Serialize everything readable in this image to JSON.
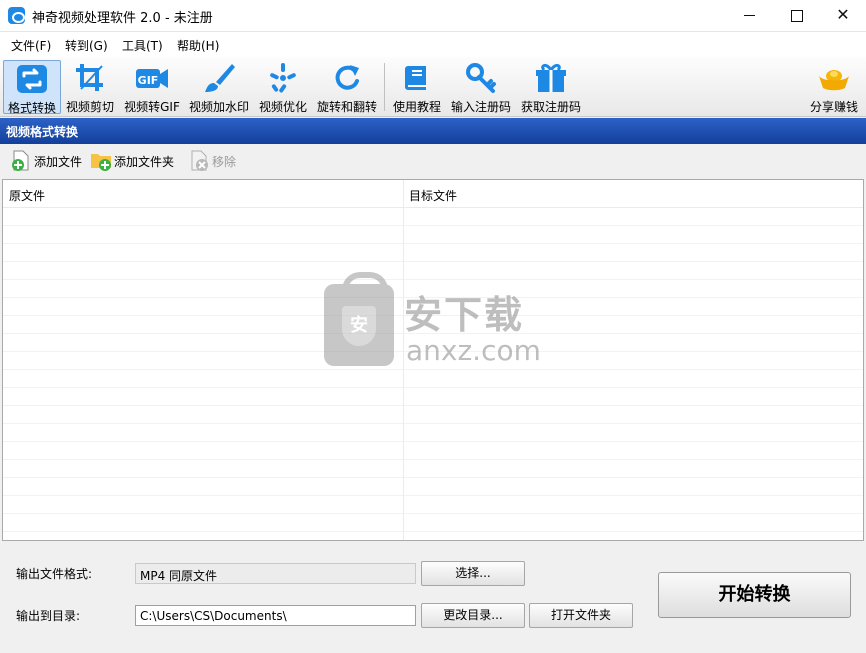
{
  "window": {
    "title": "神奇视频处理软件 2.0 - 未注册",
    "controls": {
      "minimize": "",
      "maximize": "",
      "close": "✕"
    }
  },
  "menu": [
    {
      "label": "文件(F)"
    },
    {
      "label": "转到(G)"
    },
    {
      "label": "工具(T)"
    },
    {
      "label": "帮助(H)"
    }
  ],
  "toolbar": {
    "items": [
      {
        "label": "格式转换",
        "icon": "format-convert-icon",
        "active": true
      },
      {
        "label": "视频剪切",
        "icon": "crop-icon"
      },
      {
        "label": "视频转GIF",
        "icon": "gif-icon"
      },
      {
        "label": "视频加水印",
        "icon": "brush-icon"
      },
      {
        "label": "视频优化",
        "icon": "optimize-icon"
      },
      {
        "label": "旋转和翻转",
        "icon": "rotate-icon"
      },
      {
        "label": "使用教程",
        "icon": "book-icon"
      },
      {
        "label": "输入注册码",
        "icon": "key-icon"
      },
      {
        "label": "获取注册码",
        "icon": "gift-icon"
      }
    ],
    "share": {
      "label": "分享赚钱",
      "icon": "gold-ingot-icon"
    }
  },
  "section": {
    "title": "视频格式转换"
  },
  "file_actions": {
    "add_file": "添加文件",
    "add_folder": "添加文件夹",
    "remove": "移除"
  },
  "table": {
    "columns": [
      "原文件",
      "目标文件"
    ],
    "rows": []
  },
  "watermark": {
    "cn": "安下载",
    "en": "anxz.com",
    "shield": "安"
  },
  "output": {
    "format_label": "输出文件格式:",
    "format_value": "MP4 同原文件",
    "select_button": "选择...",
    "dir_label": "输出到目录:",
    "dir_value": "C:\\Users\\CS\\Documents\\",
    "change_dir_button": "更改目录...",
    "open_folder_button": "打开文件夹",
    "start_button": "开始转换"
  },
  "colors": {
    "accent": "#1f53b8",
    "icon_blue": "#1e88e5",
    "active_bg": "#cfe3fb"
  }
}
